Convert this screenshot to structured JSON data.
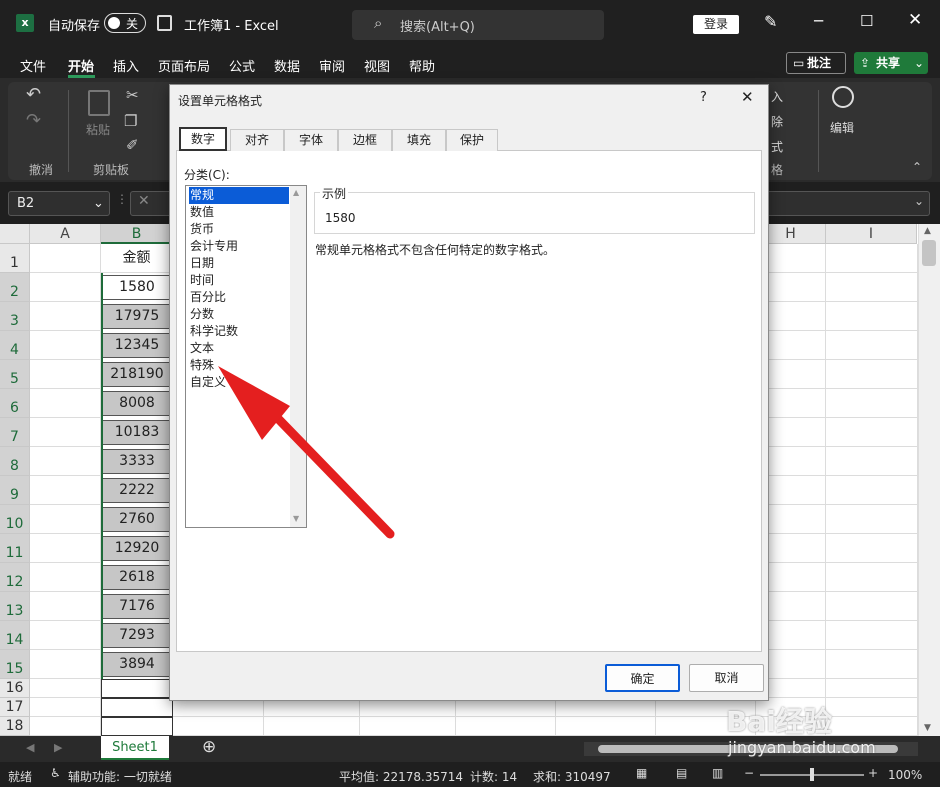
{
  "titlebar": {
    "autosave_label": "自动保存",
    "autosave_state": "关",
    "title": "工作簿1  -  Excel",
    "search_placeholder": "搜索(Alt+Q)",
    "login": "登录"
  },
  "menu": [
    "文件",
    "开始",
    "插入",
    "页面布局",
    "公式",
    "数据",
    "审阅",
    "视图",
    "帮助"
  ],
  "menu_right": {
    "comments": "批注",
    "share": "共享"
  },
  "ribbon": {
    "undo_group": "撤消",
    "paste": "粘贴",
    "clipboard_group": "剪贴板",
    "edit": "编辑",
    "partial": [
      "入",
      "除",
      "式",
      "格"
    ]
  },
  "formula_bar": {
    "name_box": "B2"
  },
  "columns": [
    "A",
    "B",
    "H",
    "I"
  ],
  "rows": [
    "1",
    "2",
    "3",
    "4",
    "5",
    "6",
    "7",
    "8",
    "9",
    "10",
    "11",
    "12",
    "13",
    "14",
    "15",
    "16",
    "17",
    "18"
  ],
  "header_cell": "金额",
  "values": [
    "1580",
    "17975",
    "12345",
    "218190",
    "8008",
    "10183",
    "3333",
    "2222",
    "2760",
    "12920",
    "2618",
    "7176",
    "7293",
    "3894"
  ],
  "sheet_tab": "Sheet1",
  "status": {
    "ready": "就绪",
    "accessibility": "辅助功能: 一切就绪",
    "average": "平均值: 22178.35714",
    "count": "计数: 14",
    "sum": "求和: 310497",
    "zoom": "100%"
  },
  "dialog": {
    "title": "设置单元格格式",
    "tabs": [
      "数字",
      "对齐",
      "字体",
      "边框",
      "填充",
      "保护"
    ],
    "category_label": "分类(C):",
    "categories": [
      "常规",
      "数值",
      "货币",
      "会计专用",
      "日期",
      "时间",
      "百分比",
      "分数",
      "科学记数",
      "文本",
      "特殊",
      "自定义"
    ],
    "sample_label": "示例",
    "sample_value": "1580",
    "description": "常规单元格格式不包含任何特定的数字格式。",
    "ok": "确定",
    "cancel": "取消"
  },
  "watermark": {
    "brand": "Bai经验",
    "url": "jingyan.baidu.com"
  },
  "colors": {
    "accent": "#0b5cd7",
    "share": "#1f7a3a",
    "arrow": "#e41f1f"
  }
}
